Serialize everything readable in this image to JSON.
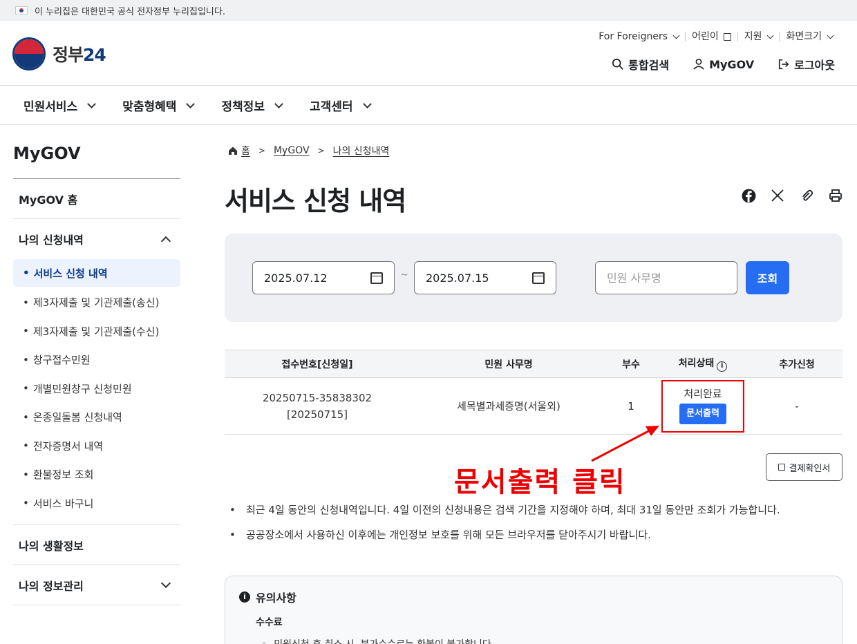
{
  "topbar": {
    "notice": "이 누리집은 대한민국 공식 전자정부 누리집입니다."
  },
  "header": {
    "logo_text": "정부",
    "logo_num": "24",
    "utility": [
      "For Foreigners",
      "어린이",
      "지원",
      "화면크기"
    ],
    "actions": {
      "search": "통합검색",
      "mygov": "MyGOV",
      "logout": "로그아웃"
    }
  },
  "gnb": [
    "민원서비스",
    "맞춤형혜택",
    "정책정보",
    "고객센터"
  ],
  "lnb": {
    "title": "MyGOV",
    "home": "MyGOV 홈",
    "section1": "나의 신청내역",
    "sub_items": [
      "서비스 신청 내역",
      "제3자제출 및 기관제출(송신)",
      "제3자제출 및 기관제출(수신)",
      "창구접수민원",
      "개별민원창구 신청민원",
      "온종일돌봄 신청내역",
      "전자증명서 내역",
      "환불정보 조회",
      "서비스 바구니"
    ],
    "section2": "나의 생활정보",
    "section3": "나의 정보관리"
  },
  "breadcrumb": [
    "홈",
    "MyGOV",
    "나의 신청내역"
  ],
  "page_title": "서비스 신청 내역",
  "search": {
    "start_date": "2025.07.12",
    "end_date": "2025.07.15",
    "separator": "~",
    "name_placeholder": "민원 사무명",
    "button": "조회"
  },
  "table": {
    "headers": [
      "접수번호[신청일]",
      "민원 사무명",
      "부수",
      "처리상태",
      "추가신청"
    ],
    "row": {
      "receipt_no": "20250715-35838302",
      "apply_date": "[20250715]",
      "name": "세목별과세증명(서울외)",
      "count": "1",
      "status": "처리완료",
      "print_button": "문서출력",
      "additional": "-"
    }
  },
  "receipt_button": "결제확인서",
  "annotation": "문서출력 클릭",
  "notes": [
    "최근 4일 동안의 신청내역입니다. 4일 이전의 신청내용은 검색 기간을 지정해야 하며, 최대 31일 동안만 조회가 가능합니다.",
    "공공장소에서 사용하신 이후에는 개인정보 보호를 위해 모든 브라우저를 닫아주시기 바랍니다."
  ],
  "caution": {
    "title": "유의사항",
    "subtitle": "수수료",
    "item": "민원신청 후 취소 시, 부가수수료는 환불이 불가합니다."
  },
  "colors": {
    "primary": "#256ef4",
    "annotation": "#e00000",
    "active_bg": "#ecf2fe"
  }
}
